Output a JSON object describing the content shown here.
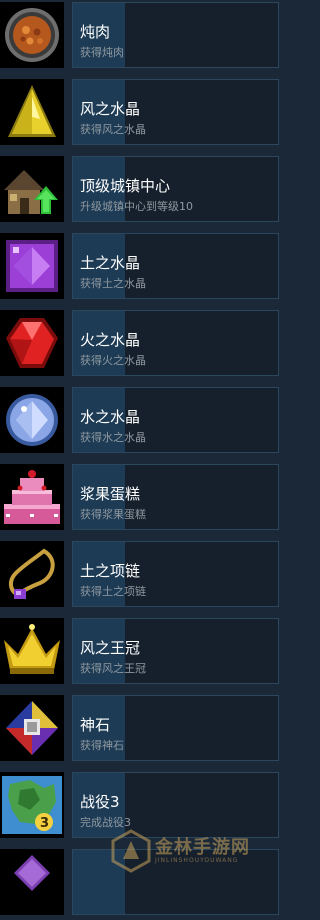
{
  "achievements": [
    {
      "title": "炖肉",
      "desc": "获得炖肉",
      "icon": "stew-bowl-icon"
    },
    {
      "title": "风之水晶",
      "desc": "获得风之水晶",
      "icon": "wind-crystal-icon"
    },
    {
      "title": "顶级城镇中心",
      "desc": "升级城镇中心到等级10",
      "icon": "town-center-upgrade-icon"
    },
    {
      "title": "土之水晶",
      "desc": "获得土之水晶",
      "icon": "earth-crystal-icon"
    },
    {
      "title": "火之水晶",
      "desc": "获得火之水晶",
      "icon": "fire-crystal-icon"
    },
    {
      "title": "水之水晶",
      "desc": "获得水之水晶",
      "icon": "water-crystal-icon"
    },
    {
      "title": "浆果蛋糕",
      "desc": "获得浆果蛋糕",
      "icon": "berry-cake-icon"
    },
    {
      "title": "土之项链",
      "desc": "获得土之项链",
      "icon": "earth-necklace-icon"
    },
    {
      "title": "风之王冠",
      "desc": "获得风之王冠",
      "icon": "wind-crown-icon"
    },
    {
      "title": "神石",
      "desc": "获得神石",
      "icon": "god-stone-icon"
    },
    {
      "title": "战役3",
      "desc": "完成战役3",
      "icon": "campaign-map-icon"
    },
    {
      "title": "",
      "desc": "",
      "icon": "partial-item-icon"
    }
  ],
  "watermark": {
    "text": "金林手游网",
    "sub": "JINLINSHOUYOUWANG"
  },
  "colors": {
    "background": "#1b2838",
    "panel": "#16202d",
    "panel_border": "#2a475e",
    "accent": "#1d3b55",
    "title": "#ffffff",
    "desc": "#8f98a0"
  }
}
